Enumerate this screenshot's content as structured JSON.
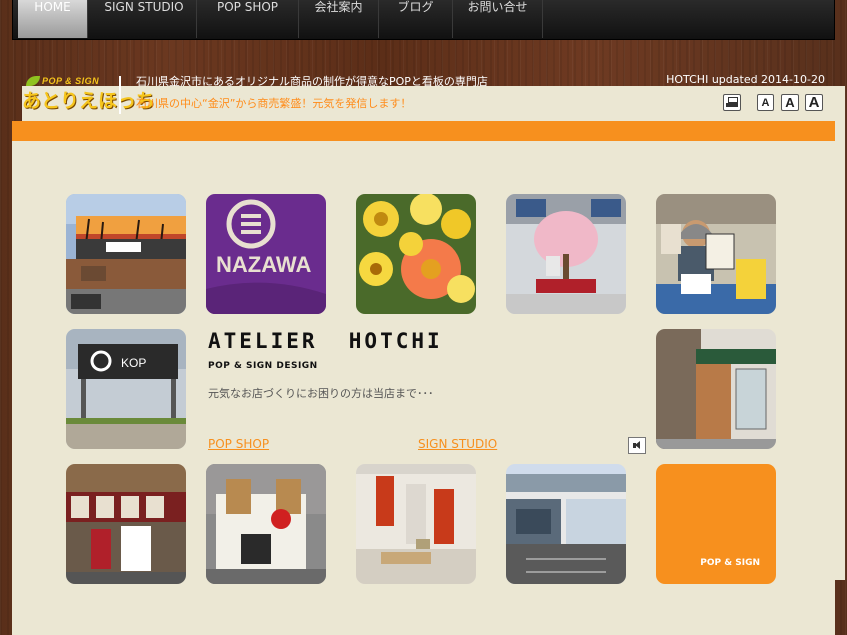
{
  "nav": {
    "items": [
      {
        "label": "HOME",
        "active": true
      },
      {
        "label": "SIGN STUDIO",
        "active": false
      },
      {
        "label": "POP SHOP",
        "active": false
      },
      {
        "label": "会社案内",
        "active": false
      },
      {
        "label": "ブログ",
        "active": false
      },
      {
        "label": "お問い合せ",
        "active": false
      }
    ]
  },
  "header": {
    "logo_top": "POP & SIGN",
    "logo_main": "あとりえほっち",
    "tagline1": "石川県金沢市にあるオリジナル商品の制作が得意なPOPと看板の専門店",
    "tagline2": "石川県の中心“金沢”から商売繁盛！元気を発信します！",
    "updated": "HOTCHI updated 2014-10-20",
    "font_buttons": [
      "A",
      "A",
      "A"
    ]
  },
  "main": {
    "title": "ATELIER  HOTCHI",
    "subtitle": "POP & SIGN DESIGN",
    "description": "元気なお店づくりにお困りの方は当店まで･･･",
    "link_popshop": "POP SHOP",
    "link_signstudio": "SIGN STUDIO",
    "orange_tile_label": "POP & SIGN",
    "tiles": [
      {
        "name": "billboard-photo"
      },
      {
        "name": "kanazawa-cloth-photo"
      },
      {
        "name": "flowers-photo"
      },
      {
        "name": "cherry-tree-photo"
      },
      {
        "name": "artist-photo"
      },
      {
        "name": "kop-sign-photo"
      },
      {
        "name": "storefront-awning-photo"
      },
      {
        "name": "noodle-shop-photo"
      },
      {
        "name": "dog-sign-photo"
      },
      {
        "name": "red-curtain-photo"
      },
      {
        "name": "building-photo"
      }
    ]
  },
  "colors": {
    "accent": "#f7901e",
    "content_bg": "#ebe7d3",
    "nav_bg": "#1a1a1a"
  }
}
